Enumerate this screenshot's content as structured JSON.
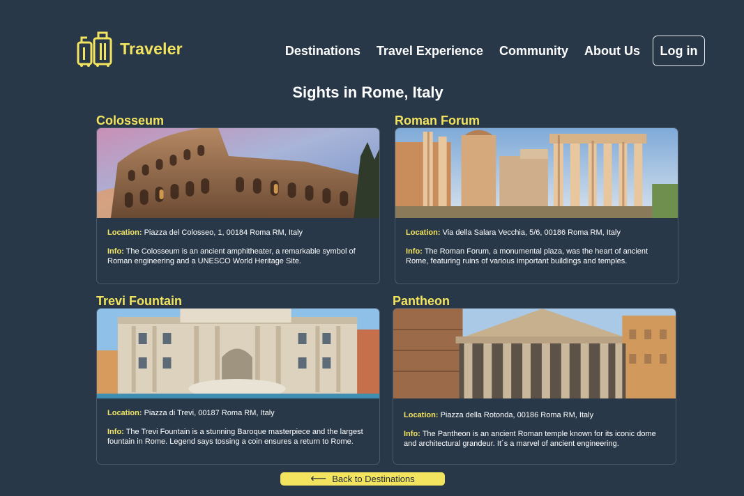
{
  "brand": {
    "name": "Traveler",
    "icon": "suitcase-icon",
    "color": "#f2e45e"
  },
  "nav": {
    "links": [
      "Destinations",
      "Travel Experience",
      "Community",
      "About Us"
    ],
    "login_label": "Log in"
  },
  "page_title": "Sights in Rome, Italy",
  "labels": {
    "location": "Location:",
    "info": "Info:"
  },
  "sights": [
    {
      "name": "Colosseum",
      "location": "Piazza del Colosseo, 1, 00184 Roma RM, Italy",
      "info": "The Colosseum is an ancient amphitheater, a remarkable symbol of Roman engineering and a UNESCO World Heritage Site."
    },
    {
      "name": "Roman Forum",
      "location": "Via della Salara Vecchia, 5/6, 00186 Roma RM, Italy",
      "info": "The Roman Forum, a monumental plaza, was the heart of ancient Rome, featuring ruins of various important buildings and temples."
    },
    {
      "name": "Trevi Fountain",
      "location": "Piazza di Trevi, 00187 Roma RM, Italy",
      "info": "The Trevi Fountain is a stunning Baroque masterpiece and the largest fountain in Rome. Legend says tossing a coin ensures a return to Rome."
    },
    {
      "name": "Pantheon",
      "location": "Piazza della Rotonda, 00186 Roma RM, Italy",
      "info": "The Pantheon is an ancient Roman temple known for its iconic dome and architectural grandeur. It´s a marvel of ancient engineering."
    }
  ],
  "back_button": {
    "label": "Back to Destinations",
    "icon": "arrow-left-icon"
  },
  "colors": {
    "background": "#293849",
    "accent": "#f2e45e"
  }
}
